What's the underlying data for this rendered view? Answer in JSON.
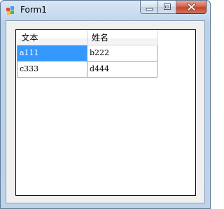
{
  "window": {
    "title": "Form1",
    "icon": "windows-form-icon",
    "buttons": {
      "minimize_icon": "minimize-icon",
      "maximize_icon": "maximize-icon",
      "close_icon": "close-icon"
    }
  },
  "grid": {
    "columns": [
      "文本",
      "姓名"
    ],
    "rows": [
      [
        "a111",
        "b222"
      ],
      [
        "c333",
        "d444"
      ]
    ],
    "selected_cell": {
      "row": 0,
      "column": 0
    }
  },
  "colors": {
    "selection": "#3399ff",
    "close_button": "#c44529",
    "title_bar": "#c3d7ec"
  }
}
